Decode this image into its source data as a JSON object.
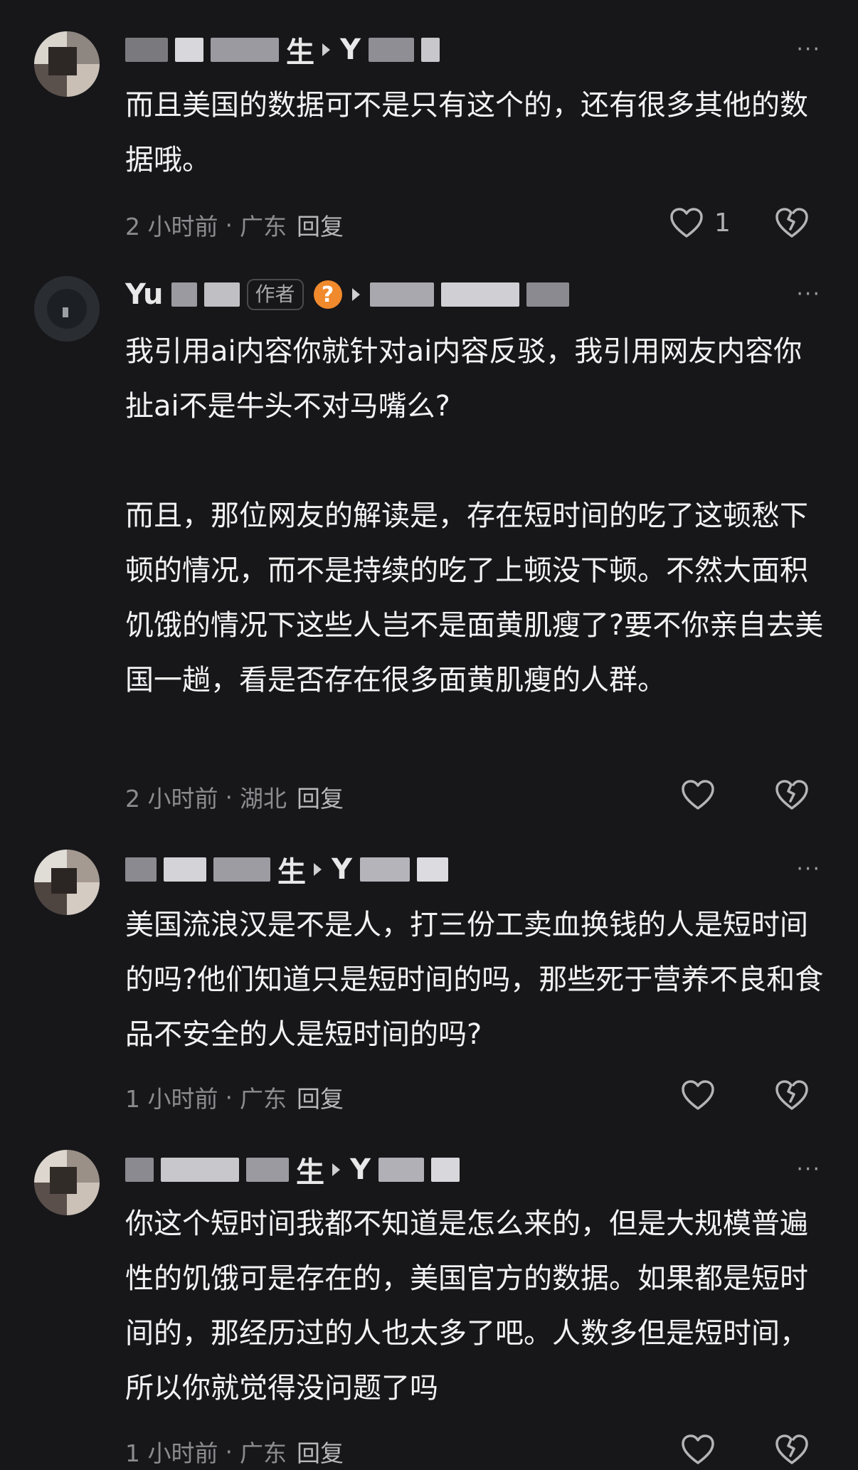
{
  "comments": [
    {
      "username_visible": "Y",
      "title_fragment": "生",
      "text": "而且美国的数据可不是只有这个的，还有很多其他的数据哦。",
      "time": "2 小时前",
      "location": "广东",
      "reply_label": "回复",
      "likes": "1"
    },
    {
      "username_visible": "Yu",
      "author_tag": "作者",
      "coin_icon_glyph": "?",
      "text": "我引用ai内容你就针对ai内容反驳，我引用网友内容你扯ai不是牛头不对马嘴么?\n\n而且，那位网友的解读是，存在短时间的吃了这顿愁下顿的情况，而不是持续的吃了上顿没下顿。不然大面积饥饿的情况下这些人岂不是面黄肌瘦了?要不你亲自去美国一趟，看是否存在很多面黄肌瘦的人群。",
      "time": "2 小时前",
      "location": "湖北",
      "reply_label": "回复",
      "likes": ""
    },
    {
      "username_visible": "Y",
      "title_fragment": "生",
      "text": "美国流浪汉是不是人，打三份工卖血换钱的人是短时间的吗?他们知道只是短时间的吗，那些死于营养不良和食品不安全的人是短时间的吗?",
      "time": "1 小时前",
      "location": "广东",
      "reply_label": "回复",
      "likes": ""
    },
    {
      "username_visible": "Y",
      "title_fragment": "生",
      "text": "你这个短时间我都不知道是怎么来的，但是大规模普遍性的饥饿可是存在的，美国官方的数据。如果都是短时间的，那经历过的人也太多了吧。人数多但是短时间，所以你就觉得没问题了吗",
      "time": "1 小时前",
      "location": "广东",
      "reply_label": "回复",
      "likes": ""
    }
  ],
  "more_label": "···",
  "separator": "·"
}
